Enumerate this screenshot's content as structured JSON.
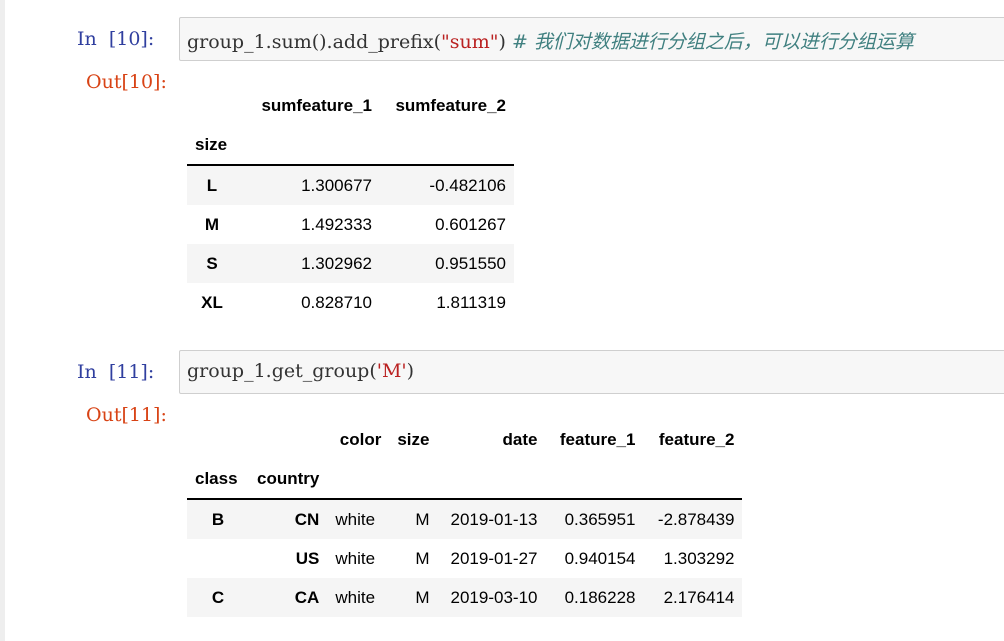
{
  "cells": [
    {
      "in_prompt": "In  [10]:",
      "code_parts": [
        "group_1.sum().add_prefix(",
        "\"sum\"",
        ") ",
        "# 我们对数据进行分组之后，可以进行分组运算"
      ],
      "out_prompt": "Out[10]:",
      "table": {
        "columns": [
          "sumfeature_1",
          "sumfeature_2"
        ],
        "index_name": "size",
        "rows": [
          {
            "index": "L",
            "values": [
              "1.300677",
              "-0.482106"
            ]
          },
          {
            "index": "M",
            "values": [
              "1.492333",
              "0.601267"
            ]
          },
          {
            "index": "S",
            "values": [
              "1.302962",
              "0.951550"
            ]
          },
          {
            "index": "XL",
            "values": [
              "0.828710",
              "1.811319"
            ]
          }
        ]
      }
    },
    {
      "in_prompt": "In  [11]:",
      "code_parts": [
        "group_1.get_group(",
        "'M'",
        ")"
      ],
      "out_prompt": "Out[11]:",
      "table": {
        "columns": [
          "color",
          "size",
          "date",
          "feature_1",
          "feature_2"
        ],
        "index_names": [
          "class",
          "country"
        ],
        "rows": [
          {
            "index": [
              "B",
              "CN"
            ],
            "values": [
              "white",
              "M",
              "2019-01-13",
              "0.365951",
              "-2.878439"
            ]
          },
          {
            "index": [
              "",
              "US"
            ],
            "values": [
              "white",
              "M",
              "2019-01-27",
              "0.940154",
              "1.303292"
            ]
          },
          {
            "index": [
              "C",
              "CA"
            ],
            "values": [
              "white",
              "M",
              "2019-03-10",
              "0.186228",
              "2.176414"
            ]
          }
        ]
      }
    }
  ]
}
